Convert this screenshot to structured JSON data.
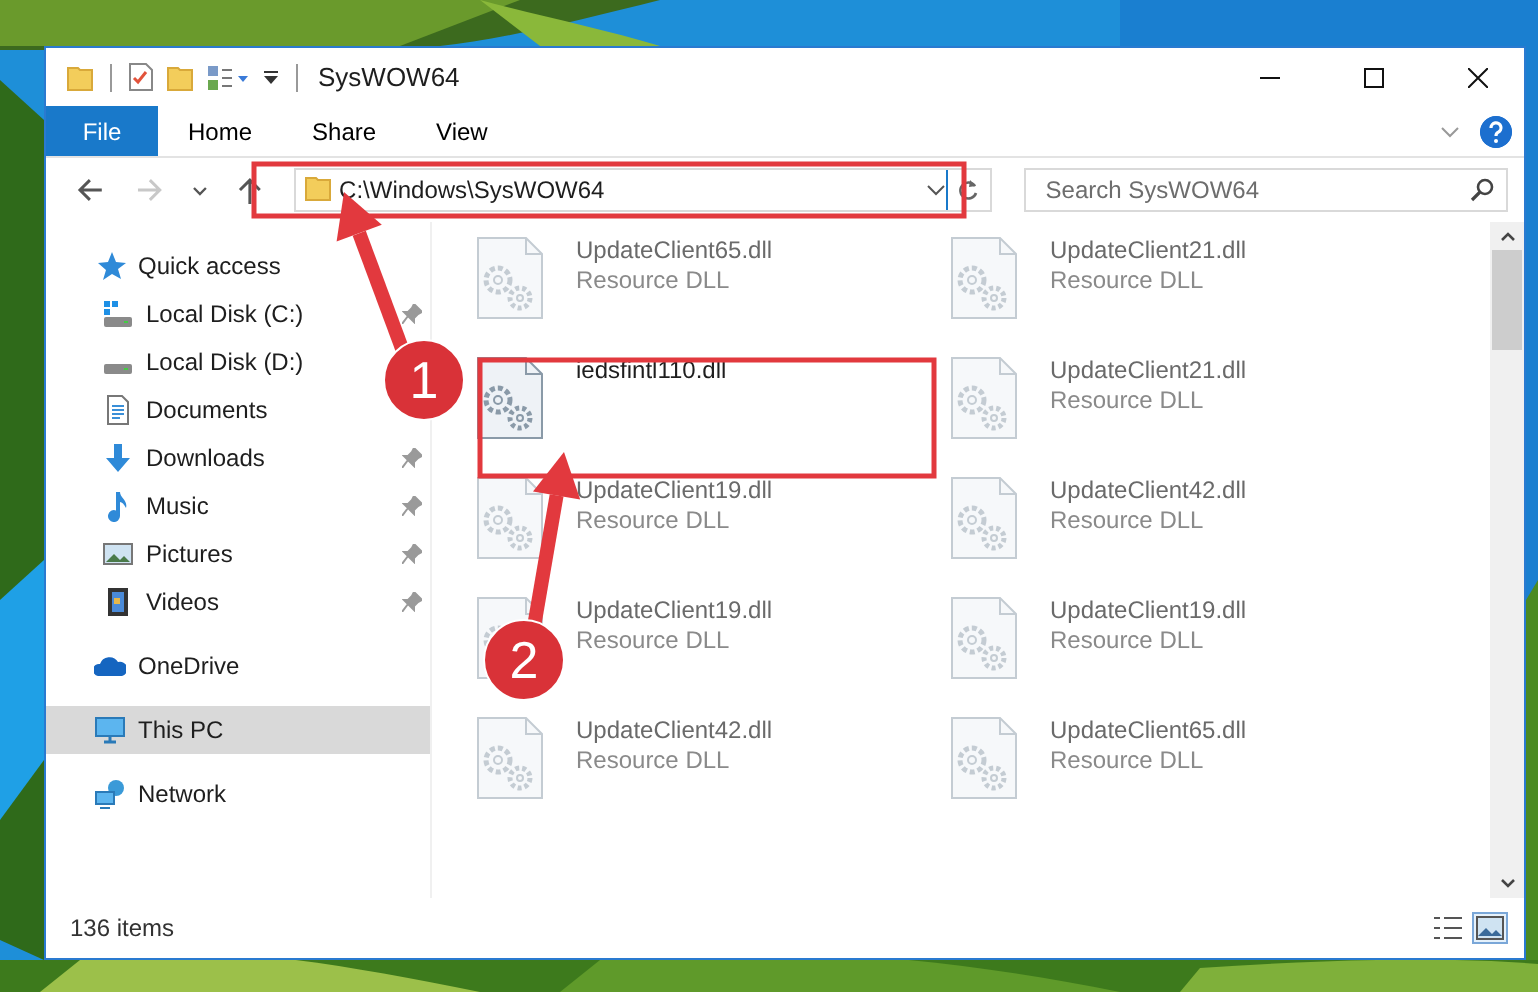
{
  "window": {
    "title": "SysWOW64"
  },
  "ribbon": {
    "file_button": "File",
    "tabs": [
      {
        "label": "Home",
        "selected": false
      },
      {
        "label": "Share",
        "selected": false
      },
      {
        "label": "View",
        "selected": false
      }
    ]
  },
  "nav": [
    {
      "kind": "back",
      "disabled": false
    },
    {
      "kind": "forward",
      "disabled": true
    },
    {
      "kind": "recent",
      "disabled": false
    },
    {
      "kind": "up",
      "disabled": false
    }
  ],
  "address": {
    "value": "C:\\Windows\\SysWOW64"
  },
  "search": {
    "placeholder": "Search SysWOW64"
  },
  "sidebar": {
    "items": [
      {
        "label": "Quick access",
        "kind": "star",
        "selected": false,
        "children": [
          {
            "label": "Local Disk (C:)",
            "kind": "drive-c",
            "pinned": true,
            "selected": false
          },
          {
            "label": "Local Disk (D:)",
            "kind": "drive",
            "pinned": false,
            "selected": false
          },
          {
            "label": "Documents",
            "kind": "documents",
            "pinned": false,
            "selected": false
          },
          {
            "label": "Downloads",
            "kind": "downloads",
            "pinned": true,
            "selected": false
          },
          {
            "label": "Music",
            "kind": "music",
            "pinned": true,
            "selected": false
          },
          {
            "label": "Pictures",
            "kind": "pictures",
            "pinned": true,
            "selected": false
          },
          {
            "label": "Videos",
            "kind": "videos",
            "pinned": true,
            "selected": false
          }
        ]
      },
      {
        "label": "OneDrive",
        "kind": "cloud",
        "selected": false
      },
      {
        "label": "This PC",
        "kind": "pc",
        "selected": true
      },
      {
        "label": "Network",
        "kind": "network",
        "selected": false
      }
    ]
  },
  "files": [
    {
      "name": "UpdateClient65.dll",
      "type": "Resource DLL",
      "blurred": true
    },
    {
      "name": "UpdateClient21.dll",
      "type": "Resource DLL",
      "blurred": true
    },
    {
      "name": "iedsfintl110.dll",
      "blurred": false
    },
    {
      "name": "UpdateClient21.dll",
      "type": "Resource DLL",
      "blurred": true
    },
    {
      "name": "UpdateClient19.dll",
      "type": "Resource DLL",
      "blurred": true
    },
    {
      "name": "UpdateClient42.dll",
      "type": "Resource DLL",
      "blurred": true
    },
    {
      "name": "UpdateClient19.dll",
      "type": "Resource DLL",
      "blurred": true
    },
    {
      "name": "UpdateClient19.dll",
      "type": "Resource DLL",
      "blurred": true
    },
    {
      "name": "UpdateClient42.dll",
      "type": "Resource DLL",
      "blurred": true
    },
    {
      "name": "UpdateClient65.dll",
      "type": "Resource DLL",
      "blurred": true
    }
  ],
  "status_bar": {
    "count": "136 items",
    "views": [
      {
        "kind": "details",
        "selected": false
      },
      {
        "kind": "large-icons",
        "selected": true
      }
    ]
  },
  "annotations": [
    {
      "label": "1"
    },
    {
      "label": "2"
    }
  ]
}
